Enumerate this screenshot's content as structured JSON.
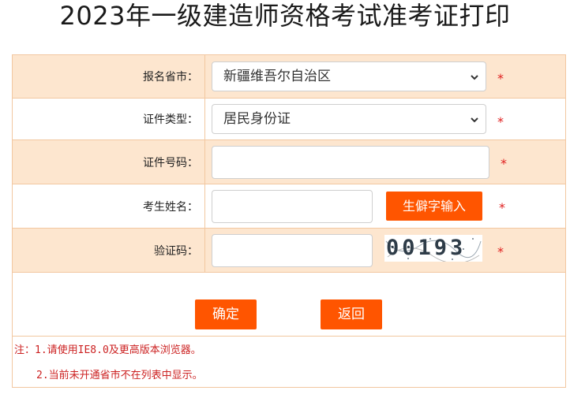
{
  "page": {
    "title": "2023年一级建造师资格考试准考证打印"
  },
  "form": {
    "province": {
      "label": "报名省市：",
      "value": "新疆维吾尔自治区",
      "required": "*"
    },
    "id_type": {
      "label": "证件类型：",
      "value": "居民身份证",
      "required": "*"
    },
    "id_number": {
      "label": "证件号码：",
      "value": "",
      "required": "*"
    },
    "name": {
      "label": "考生姓名：",
      "value": "",
      "rare_char_button": "生僻字输入",
      "required": "*"
    },
    "captcha": {
      "label": "验证码：",
      "value": "",
      "image_text": "00193",
      "required": "*"
    }
  },
  "actions": {
    "confirm_label": "确定",
    "back_label": "返回"
  },
  "notes": [
    "注：1.请使用IE8.0及更高版本浏览器。",
    "2.当前未开通省市不在列表中显示。"
  ],
  "colors": {
    "accent": "#ff5500",
    "row_shade": "#fde6cf",
    "border": "#f2c7a0",
    "required": "#e02020",
    "note": "#cc2222"
  }
}
